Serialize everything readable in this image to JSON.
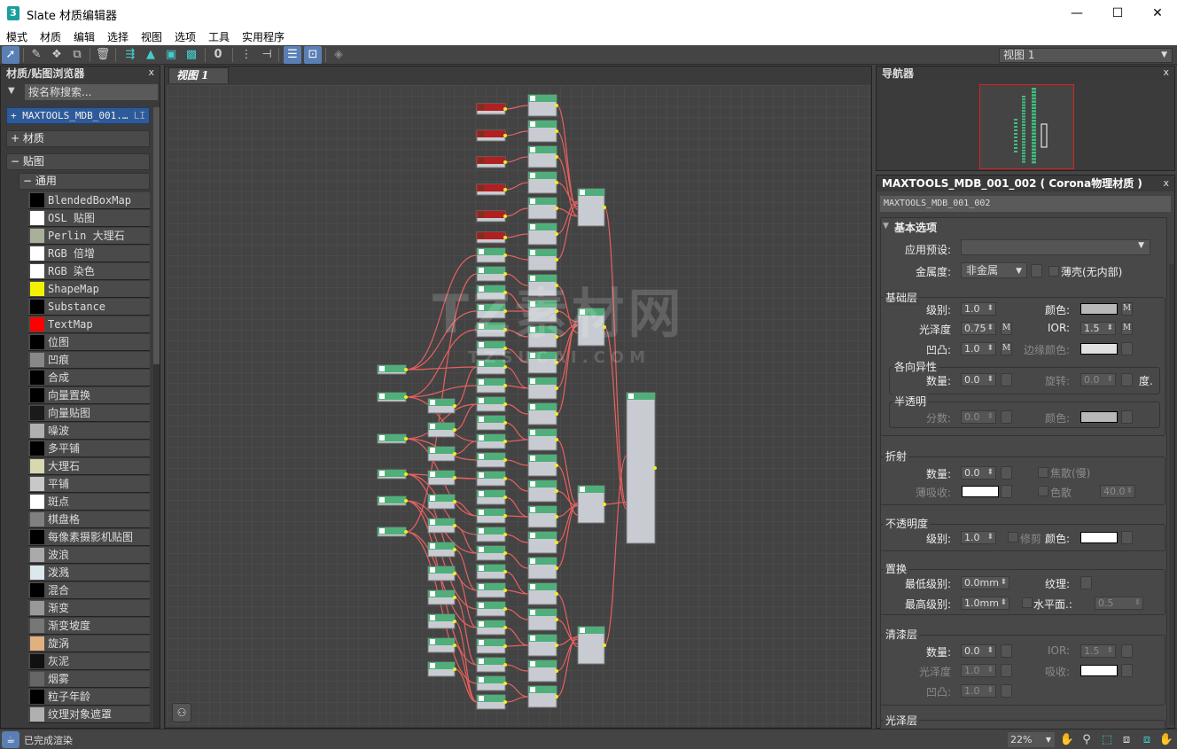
{
  "window": {
    "title": "Slate 材质编辑器",
    "logo": "3",
    "minimize": "—",
    "maximize": "☐",
    "close": "✕"
  },
  "menu": [
    "模式",
    "材质",
    "编辑",
    "选择",
    "视图",
    "选项",
    "工具",
    "实用程序"
  ],
  "toolbar": {
    "view_select": "视图 1",
    "icons": [
      "select-arrow-icon",
      "eyedropper-icon",
      "pick-material-icon",
      "put-to-scene-icon",
      "delete-icon",
      "move-children-icon",
      "hide-unused-icon",
      "show-map-icon",
      "show-background-icon",
      "layout-icon",
      "layout-children-icon",
      "lay-out-all-icon",
      "params-icon",
      "navigator-icon",
      "sample-icon"
    ]
  },
  "browser": {
    "title": "材质/贴图浏览器",
    "close": "x",
    "search_placeholder": "按名称搜索...",
    "scene_group": "+ MAXTOOLS_MDB_001.…",
    "scene_group_badge": "LI",
    "materials_group": "+ 材质",
    "maps_group": "− 贴图",
    "general_group": "− 通用",
    "maps": [
      {
        "label": "BlendedBoxMap",
        "swatch": "#000000"
      },
      {
        "label": "OSL 贴图",
        "swatch": "#ffffff"
      },
      {
        "label": "Perlin 大理石",
        "swatch": "#a8b09a"
      },
      {
        "label": "RGB 倍增",
        "swatch": "#ffffff"
      },
      {
        "label": "RGB 染色",
        "swatch": "#ffffff"
      },
      {
        "label": "ShapeMap",
        "swatch": "#f2f200"
      },
      {
        "label": "Substance",
        "swatch": "#000000"
      },
      {
        "label": "TextMap",
        "swatch": "#ff0000"
      },
      {
        "label": "位图",
        "swatch": "#000000"
      },
      {
        "label": "凹痕",
        "swatch": "#888888"
      },
      {
        "label": "合成",
        "swatch": "#000000"
      },
      {
        "label": "向量置换",
        "swatch": "#000000"
      },
      {
        "label": "向量贴图",
        "swatch": "#1a1a1a"
      },
      {
        "label": "噪波",
        "swatch": "#b0b0b0"
      },
      {
        "label": "多平铺",
        "swatch": "#000000"
      },
      {
        "label": "大理石",
        "swatch": "#d8d8b0"
      },
      {
        "label": "平铺",
        "swatch": "#c8c8c8"
      },
      {
        "label": "斑点",
        "swatch": "#ffffff"
      },
      {
        "label": "棋盘格",
        "swatch": "#808080"
      },
      {
        "label": "每像素摄影机贴图",
        "swatch": "#000000"
      },
      {
        "label": "波浪",
        "swatch": "#aaaaaa"
      },
      {
        "label": "泼溅",
        "swatch": "#dde8ee"
      },
      {
        "label": "混合",
        "swatch": "#000000"
      },
      {
        "label": "渐变",
        "swatch": "#999999"
      },
      {
        "label": "渐变坡度",
        "swatch": "#777777"
      },
      {
        "label": "旋涡",
        "swatch": "#e0b080"
      },
      {
        "label": "灰泥",
        "swatch": "#111111"
      },
      {
        "label": "烟雾",
        "swatch": "#666666"
      },
      {
        "label": "粒子年龄",
        "swatch": "#000000"
      },
      {
        "label": "纹理对象遮罩",
        "swatch": "#b0b0b0"
      }
    ]
  },
  "viewport": {
    "tab": "视图 1",
    "watermark_main": "TZ素材网",
    "watermark_sub": "TZSUCAI.COM"
  },
  "navigator": {
    "title": "导航器",
    "close": "x"
  },
  "properties": {
    "title": "MAXTOOLS_MDB_001_002 ( Corona物理材质 )",
    "close": "x",
    "name": "MAXTOOLS_MDB_001_002",
    "basic_rollout": "基本选项",
    "preset_label": "应用预设:",
    "preset_value": "",
    "metalness_label": "金属度:",
    "metalness_value": "非金属",
    "thin_shell": "薄壳(无内部)",
    "base": {
      "title": "基础层",
      "level_label": "级别:",
      "level": "1.0",
      "color_label": "颜色:",
      "color": "#b8b8b8",
      "gloss_label": "光泽度",
      "gloss": "0.75",
      "ior_label": "IOR:",
      "ior": "1.5",
      "bump_label": "凹凸:",
      "bump": "1.0",
      "edge_label": "边缘颜色:",
      "edge_color": "#e0e0e0",
      "m": "M"
    },
    "aniso": {
      "title": "各向异性",
      "amount_label": "数量:",
      "amount": "0.0",
      "rot_label": "旋转:",
      "rot": "0.0",
      "deg": "度."
    },
    "translucency": {
      "title": "半透明",
      "frac_label": "分数:",
      "frac": "0.0",
      "color_label": "颜色:",
      "color": "#b8b8b8"
    },
    "refraction": {
      "title": "折射",
      "amount_label": "数量:",
      "amount": "0.0",
      "caustics": "焦散(慢)",
      "thin_abs_label": "薄吸收:",
      "dispersion": "色散",
      "abbe": "40.0"
    },
    "opacity": {
      "title": "不透明度",
      "level_label": "级别:",
      "level": "1.0",
      "clip": "修剪",
      "color_label": "颜色:"
    },
    "displacement": {
      "title": "置换",
      "min_label": "最低级别:",
      "min": "0.0mm",
      "max_label": "最高级别:",
      "max": "1.0mm",
      "tex_label": "纹理:",
      "water_label": "水平面.:",
      "water": "0.5"
    },
    "clearcoat": {
      "title": "清漆层",
      "amount_label": "数量:",
      "amount": "0.0",
      "ior_label": "IOR:",
      "ior": "1.5",
      "gloss_label": "光泽度",
      "gloss": "1.0",
      "abs_label": "吸收:",
      "bump_label": "凹凸:",
      "bump": "1.0"
    },
    "sheen": {
      "title": "光泽层"
    }
  },
  "status": {
    "text": "已完成渲染",
    "zoom": "22%"
  }
}
